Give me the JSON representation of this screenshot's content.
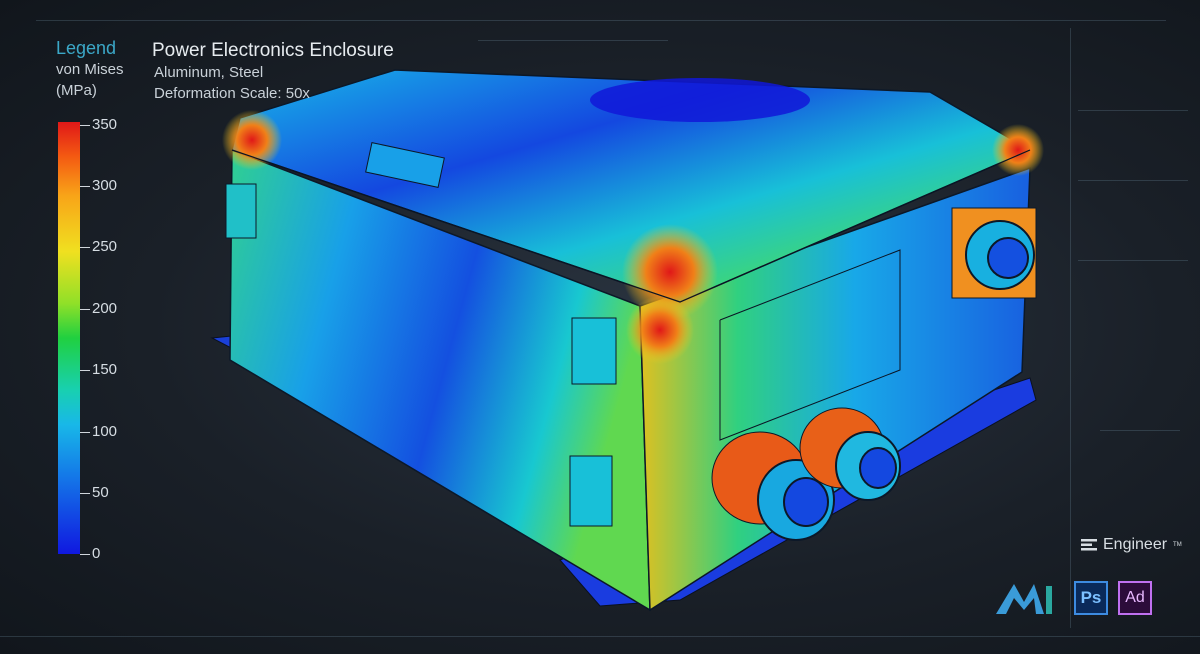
{
  "legend": {
    "title": "Legend",
    "quantity": "von Mises",
    "unit": "(MPa)",
    "ticks": [
      "350",
      "300",
      "250",
      "200",
      "150",
      "100",
      "50",
      "0"
    ]
  },
  "model": {
    "title": "Power Electronics Enclosure",
    "materials": "Aluminum, Steel",
    "deformation": "Deformation Scale: 50x"
  },
  "branding": {
    "engineer_label": "Engineer",
    "trademark": "TM",
    "ps_label": "Ps",
    "ad_label": "Ad"
  },
  "colors": {
    "legend_title": "#3ba8c8",
    "stress_max": "#e01818",
    "stress_min": "#1018e0"
  }
}
